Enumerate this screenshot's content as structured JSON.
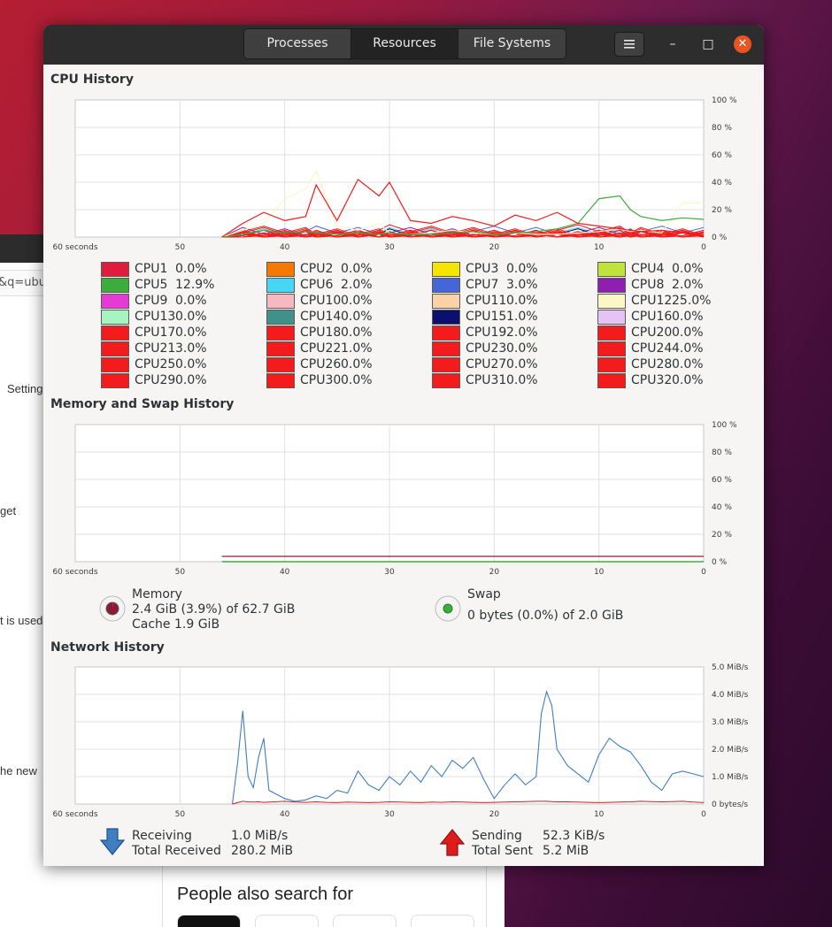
{
  "background": {
    "url_fragment": "&q=ubu",
    "left_texts": [
      "Setting",
      "get",
      "t is used",
      "he new"
    ],
    "people_also": "People also search for"
  },
  "tabs": [
    "Processes",
    "Resources",
    "File Systems"
  ],
  "header": {
    "menu_icon": "hamburger-menu-icon",
    "minimize": "–",
    "maximize": "□",
    "close": "✕"
  },
  "cpu": {
    "title": "CPU History",
    "y_labels": [
      "100 %",
      "80 %",
      "60 %",
      "40 %",
      "20 %",
      "0 %"
    ],
    "x_labels": [
      "60 seconds",
      "50",
      "40",
      "30",
      "20",
      "10",
      "0"
    ],
    "cores": [
      {
        "name": "CPU1",
        "value": "0.0%",
        "color": "#e01b3c"
      },
      {
        "name": "CPU2",
        "value": "0.0%",
        "color": "#f57900"
      },
      {
        "name": "CPU3",
        "value": "0.0%",
        "color": "#f5e300"
      },
      {
        "name": "CPU4",
        "value": "0.0%",
        "color": "#c0e23c"
      },
      {
        "name": "CPU5",
        "value": "12.9%",
        "color": "#3cad3c"
      },
      {
        "name": "CPU6",
        "value": "2.0%",
        "color": "#45d7f5"
      },
      {
        "name": "CPU7",
        "value": "3.0%",
        "color": "#4566d7"
      },
      {
        "name": "CPU8",
        "value": "2.0%",
        "color": "#8e1fb0"
      },
      {
        "name": "CPU9",
        "value": "0.0%",
        "color": "#e63ad7"
      },
      {
        "name": "CPU10",
        "value": "0.0%",
        "color": "#f5b9bf"
      },
      {
        "name": "CPU11",
        "value": "0.0%",
        "color": "#fbd2a5"
      },
      {
        "name": "CPU12",
        "value": "25.0%",
        "color": "#fdf6c6"
      },
      {
        "name": "CPU13",
        "value": "0.0%",
        "color": "#a6f5c0"
      },
      {
        "name": "CPU14",
        "value": "0.0%",
        "color": "#3f9189"
      },
      {
        "name": "CPU15",
        "value": "1.0%",
        "color": "#0b0f6e"
      },
      {
        "name": "CPU16",
        "value": "0.0%",
        "color": "#e5c3f5"
      },
      {
        "name": "CPU17",
        "value": "0.0%",
        "color": "#f31b1b"
      },
      {
        "name": "CPU18",
        "value": "0.0%",
        "color": "#f31b1b"
      },
      {
        "name": "CPU19",
        "value": "2.0%",
        "color": "#f31b1b"
      },
      {
        "name": "CPU20",
        "value": "0.0%",
        "color": "#f31b1b"
      },
      {
        "name": "CPU21",
        "value": "3.0%",
        "color": "#f31b1b"
      },
      {
        "name": "CPU22",
        "value": "1.0%",
        "color": "#f31b1b"
      },
      {
        "name": "CPU23",
        "value": "0.0%",
        "color": "#f31b1b"
      },
      {
        "name": "CPU24",
        "value": "4.0%",
        "color": "#f31b1b"
      },
      {
        "name": "CPU25",
        "value": "0.0%",
        "color": "#f31b1b"
      },
      {
        "name": "CPU26",
        "value": "0.0%",
        "color": "#f31b1b"
      },
      {
        "name": "CPU27",
        "value": "0.0%",
        "color": "#f31b1b"
      },
      {
        "name": "CPU28",
        "value": "0.0%",
        "color": "#f31b1b"
      },
      {
        "name": "CPU29",
        "value": "0.0%",
        "color": "#f31b1b"
      },
      {
        "name": "CPU30",
        "value": "0.0%",
        "color": "#f31b1b"
      },
      {
        "name": "CPU31",
        "value": "0.0%",
        "color": "#f31b1b"
      },
      {
        "name": "CPU32",
        "value": "0.0%",
        "color": "#f31b1b"
      }
    ]
  },
  "memory": {
    "title": "Memory and Swap History",
    "y_labels": [
      "100 %",
      "80 %",
      "60 %",
      "40 %",
      "20 %",
      "0 %"
    ],
    "x_labels": [
      "60 seconds",
      "50",
      "40",
      "30",
      "20",
      "10",
      "0"
    ],
    "mem_label": "Memory",
    "mem_detail": "2.4 GiB (3.9%) of 62.7 GiB",
    "mem_cache": "Cache 1.9 GiB",
    "swap_label": "Swap",
    "swap_detail": "0 bytes (0.0%) of 2.0 GiB",
    "mem_color": "#8c1b3a",
    "swap_color": "#3cad3c"
  },
  "network": {
    "title": "Network History",
    "y_labels": [
      "5.0 MiB/s",
      "4.0 MiB/s",
      "3.0 MiB/s",
      "2.0 MiB/s",
      "1.0 MiB/s",
      "0 bytes/s"
    ],
    "x_labels": [
      "60 seconds",
      "50",
      "40",
      "30",
      "20",
      "10",
      "0"
    ],
    "recv_label": "Receiving",
    "recv_rate": "1.0 MiB/s",
    "recv_total_label": "Total Received",
    "recv_total": "280.2 MiB",
    "send_label": "Sending",
    "send_rate": "52.3 KiB/s",
    "send_total_label": "Total Sent",
    "send_total": "5.2 MiB",
    "recv_color": "#3f7fbf",
    "send_color": "#d01b1b"
  },
  "chart_data": [
    {
      "type": "line",
      "title": "CPU History",
      "ylim": [
        0,
        100
      ],
      "xlim": [
        60,
        0
      ],
      "x": [
        46,
        44,
        42,
        40,
        38,
        37,
        35,
        33,
        31,
        30,
        28,
        26,
        24,
        22,
        20,
        18,
        16,
        14,
        12,
        10,
        8,
        7,
        6,
        4,
        2,
        0
      ],
      "series": [
        {
          "name": "CPU12",
          "values": [
            0,
            5,
            10,
            28,
            35,
            48,
            8,
            5,
            10,
            3,
            2,
            3,
            5,
            3,
            2,
            3,
            2,
            2,
            3,
            4,
            6,
            4,
            5,
            3,
            25,
            25
          ]
        },
        {
          "name": "CPU5",
          "values": [
            0,
            2,
            5,
            3,
            4,
            3,
            2,
            3,
            2,
            3,
            2,
            2,
            3,
            4,
            2,
            3,
            4,
            6,
            10,
            28,
            30,
            20,
            15,
            12,
            14,
            12.9
          ]
        },
        {
          "name": "CPU21",
          "values": [
            0,
            10,
            18,
            12,
            15,
            38,
            12,
            42,
            30,
            40,
            12,
            10,
            15,
            12,
            8,
            16,
            12,
            18,
            10,
            8,
            6,
            5,
            4,
            5,
            3,
            3
          ]
        }
      ]
    },
    {
      "type": "line",
      "title": "Memory and Swap History",
      "ylim": [
        0,
        100
      ],
      "xlim": [
        60,
        0
      ],
      "x": [
        46,
        40,
        30,
        20,
        10,
        0
      ],
      "series": [
        {
          "name": "Memory",
          "values": [
            3.9,
            3.9,
            3.9,
            3.9,
            3.9,
            3.9
          ]
        },
        {
          "name": "Swap",
          "values": [
            0,
            0,
            0,
            0,
            0,
            0
          ]
        }
      ]
    },
    {
      "type": "line",
      "title": "Network History",
      "ylabel": "MiB/s",
      "ylim": [
        0,
        5
      ],
      "xlim": [
        60,
        0
      ],
      "x": [
        45,
        44.5,
        44,
        43.5,
        43,
        42.5,
        42,
        41.5,
        41,
        40,
        39,
        38,
        37,
        36,
        35,
        34,
        33,
        32,
        31,
        30,
        29,
        28,
        27,
        26,
        25,
        24,
        23,
        22,
        21,
        20,
        19,
        18,
        17,
        16,
        15.5,
        15,
        14.5,
        14,
        13,
        12,
        11,
        10,
        9,
        8,
        7,
        6,
        5,
        4,
        3,
        2,
        1,
        0
      ],
      "series": [
        {
          "name": "Receiving",
          "values": [
            0,
            1.5,
            3.4,
            1.0,
            0.6,
            1.7,
            2.4,
            0.5,
            0.4,
            0.2,
            0.1,
            0.15,
            0.3,
            0.2,
            0.5,
            0.4,
            1.2,
            0.7,
            0.5,
            1.0,
            0.7,
            1.2,
            0.8,
            1.4,
            1.0,
            1.6,
            1.3,
            1.7,
            0.9,
            0.2,
            0.7,
            1.1,
            0.7,
            1.0,
            3.3,
            4.1,
            3.6,
            2.0,
            1.4,
            1.1,
            0.8,
            1.8,
            2.4,
            2.1,
            1.9,
            1.4,
            0.8,
            0.5,
            1.1,
            1.2,
            1.1,
            1.0
          ]
        },
        {
          "name": "Sending",
          "values": [
            0,
            0.05,
            0.1,
            0.08,
            0.07,
            0.08,
            0.06,
            0.07,
            0.08,
            0.1,
            0.07,
            0.06,
            0.08,
            0.06,
            0.05,
            0.07,
            0.06,
            0.05,
            0.06,
            0.08,
            0.07,
            0.06,
            0.05,
            0.07,
            0.06,
            0.08,
            0.07,
            0.06,
            0.05,
            0.06,
            0.07,
            0.08,
            0.09,
            0.1,
            0.1,
            0.1,
            0.09,
            0.08,
            0.08,
            0.07,
            0.06,
            0.05,
            0.06,
            0.07,
            0.08,
            0.1,
            0.09,
            0.08,
            0.09,
            0.1,
            0.07,
            0.05
          ]
        }
      ]
    }
  ]
}
